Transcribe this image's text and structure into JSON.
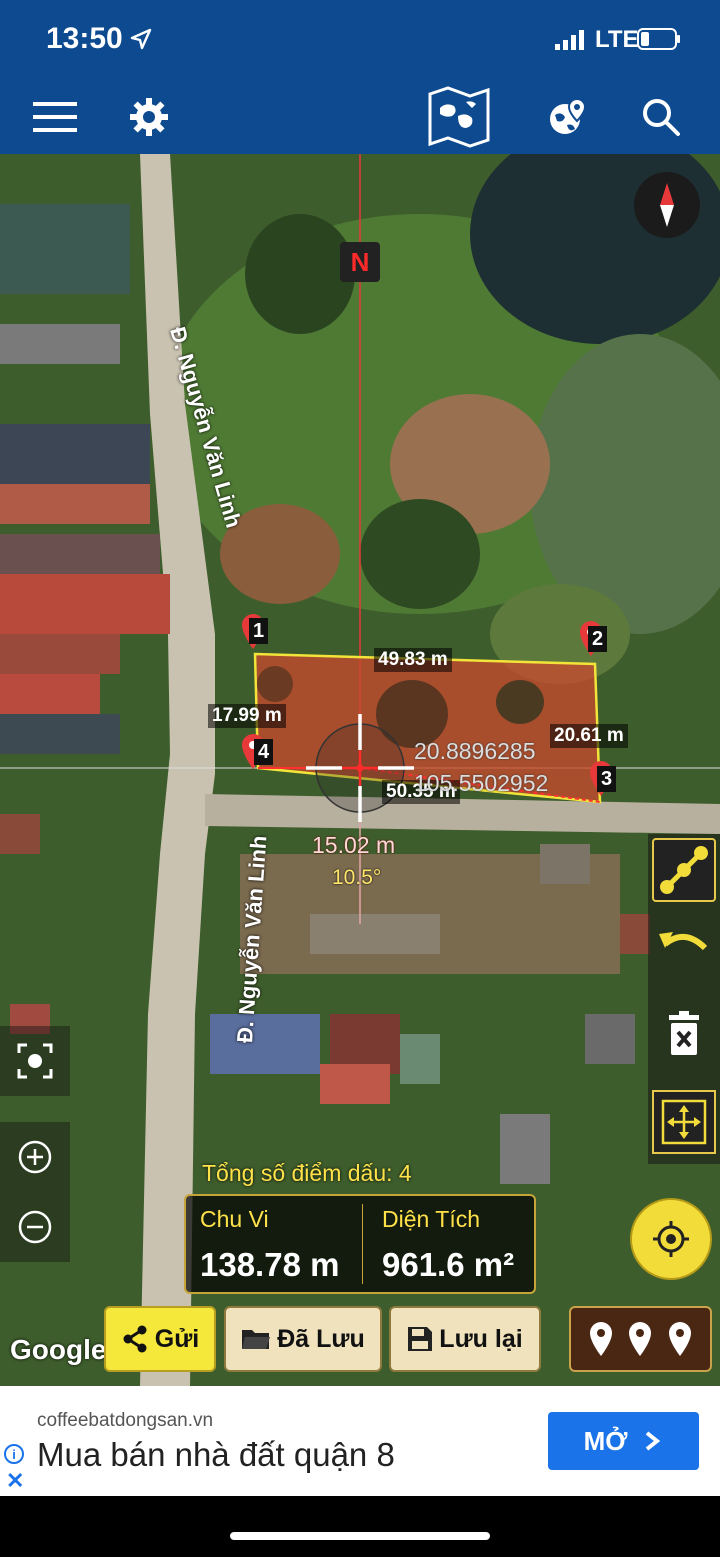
{
  "status_bar": {
    "time": "13:50",
    "network": "LTE"
  },
  "app_bar": {
    "icons": [
      "menu-icon",
      "settings-icon",
      "map-icon",
      "globe-location-icon",
      "search-icon"
    ]
  },
  "map": {
    "north_badge": "N",
    "road_labels": [
      "Đ. Nguyễn Văn Linh",
      "Đ. Nguyễn Văn Linh"
    ],
    "markers": [
      "1",
      "2",
      "3",
      "4"
    ],
    "dimensions": {
      "top_edge": "49.83 m",
      "left_edge": "17.99 m",
      "right_edge": "20.61 m",
      "bottom_edge": "50.35 m"
    },
    "crosshair": {
      "lat": "20.8896285",
      "lng": "105.5502952",
      "distance": "15.02 m",
      "angle": "10.5°"
    },
    "attribution": "Google"
  },
  "summary": {
    "point_count_label": "Tổng số điểm dấu: 4",
    "perimeter_label": "Chu Vi",
    "perimeter_value": "138.78 m",
    "area_label": "Diện Tích",
    "area_value": "961.6 m²"
  },
  "actions": {
    "share_label": "Gửi",
    "saved_label": "Đã Lưu",
    "save_label": "Lưu lại"
  },
  "side_tools": [
    "measure-line-icon",
    "undo-icon",
    "delete-icon",
    "fit-bounds-icon"
  ],
  "ad": {
    "url": "coffeebatdongsan.vn",
    "title": "Mua bán nhà đất quận 8",
    "cta": "MỞ"
  },
  "colors": {
    "app_bar": "#0d4a8f",
    "accent_yellow": "#f5e83a",
    "plot_fill": "#c84a2e",
    "ad_button": "#1a73e8"
  }
}
